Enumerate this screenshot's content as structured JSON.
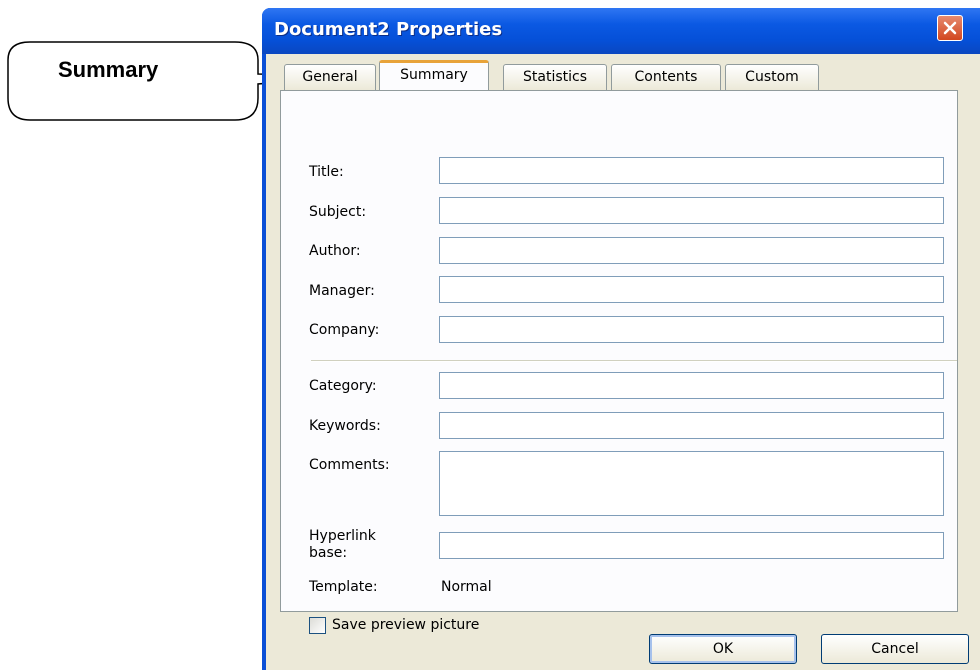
{
  "callout": {
    "text": "Summary"
  },
  "window": {
    "title": "Document2 Properties",
    "close_label": "×"
  },
  "tabs": [
    {
      "label": "General",
      "active": false
    },
    {
      "label": "Summary",
      "active": true
    },
    {
      "label": "Statistics",
      "active": false
    },
    {
      "label": "Contents",
      "active": false
    },
    {
      "label": "Custom",
      "active": false
    }
  ],
  "fields": {
    "title": {
      "label": "Title:",
      "value": ""
    },
    "subject": {
      "label": "Subject:",
      "value": ""
    },
    "author": {
      "label": "Author:",
      "value": ""
    },
    "manager": {
      "label": "Manager:",
      "value": ""
    },
    "company": {
      "label": "Company:",
      "value": ""
    },
    "category": {
      "label": "Category:",
      "value": ""
    },
    "keywords": {
      "label": "Keywords:",
      "value": ""
    },
    "comments": {
      "label": "Comments:",
      "value": ""
    },
    "hyperlink_base": {
      "label_line1": "Hyperlink",
      "label_line2": "base:",
      "value": ""
    }
  },
  "template": {
    "label": "Template:",
    "value": "Normal"
  },
  "save_preview": {
    "label": "Save preview picture",
    "checked": false
  },
  "buttons": {
    "ok": "OK",
    "cancel": "Cancel"
  },
  "colors": {
    "titlebar": "#0550d8",
    "dialog_background": "#ece9d8",
    "active_tab_accent": "#e8a33a",
    "close_button": "#d2461f"
  }
}
